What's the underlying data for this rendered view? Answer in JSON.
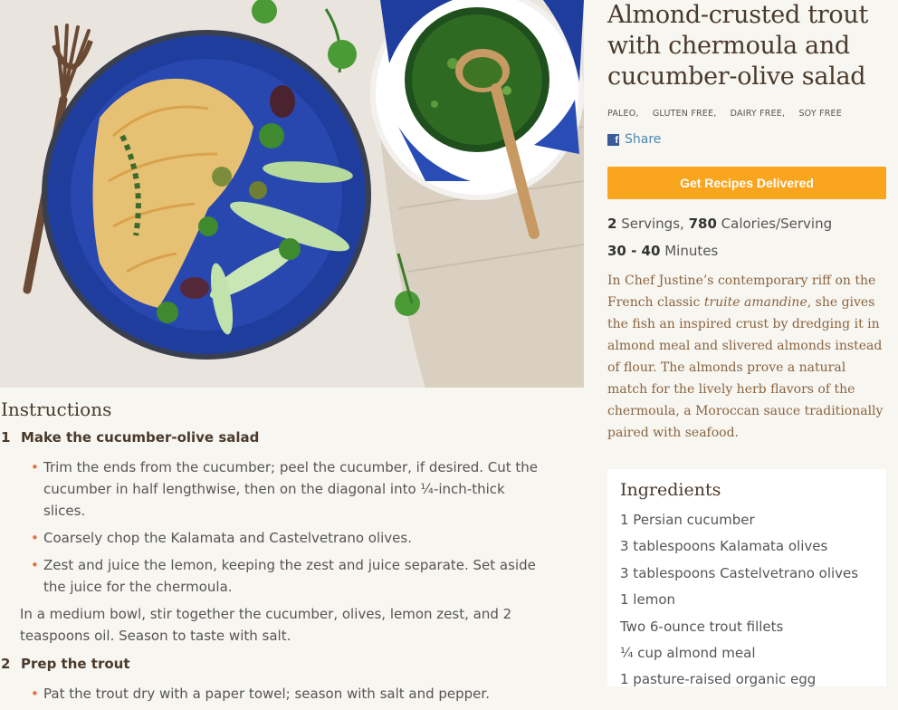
{
  "recipe": {
    "title": "Almond-crusted trout with chermoula and cucumber-olive salad",
    "tags": [
      "PALEO,",
      "GLUTEN FREE,",
      "DAIRY FREE,",
      "SOY FREE"
    ],
    "share_label": "Share",
    "cta_label": "Get Recipes Delivered",
    "servings": "2",
    "servings_label": "Servings,",
    "calories": "780",
    "calories_label": "Calories/Serving",
    "time": "30 - 40",
    "time_label": "Minutes",
    "description_before": "In Chef Justine’s contemporary riff on the French classic ",
    "description_italic": "truite amandine",
    "description_after": ", she gives the fish an inspired crust by dredging it in almond meal and slivered almonds instead of flour. The almonds prove a natural match for the lively herb flavors of the chermoula, a Moroccan sauce traditionally paired with seafood."
  },
  "instructions": {
    "title": "Instructions",
    "steps": [
      {
        "number": "1",
        "heading": "Make the cucumber-olive salad",
        "bullets": [
          "Trim the ends from the cucumber; peel the cucumber, if desired. Cut the cucumber in half lengthwise, then on the diagonal into ¼-inch-thick slices.",
          "Coarsely chop the Kalamata and Castelvetrano olives.",
          "Zest and juice the lemon, keeping the zest and juice separate. Set aside the juice for the chermoula."
        ],
        "paragraph": "In a medium bowl, stir together the cucumber, olives, lemon zest, and 2 teaspoons oil. Season to taste with salt."
      },
      {
        "number": "2",
        "heading": "Prep the trout",
        "bullets": [
          "Pat the trout dry with a paper towel; season with salt and pepper."
        ]
      }
    ]
  },
  "ingredients": {
    "title": "Ingredients",
    "items": [
      "1 Persian cucumber",
      "3 tablespoons Kalamata olives",
      "3 tablespoons Castelvetrano olives",
      "1 lemon",
      "Two 6-ounce trout fillets",
      "¼ cup almond meal",
      "1 pasture-raised organic egg"
    ]
  },
  "colors": {
    "accent_orange": "#f9a51e",
    "bullet_orange": "#e56e3a",
    "link_blue": "#4a8ab3",
    "facebook_blue": "#3b5998",
    "description_brown": "#8a6440",
    "plate_blue": "#1f3d9c"
  }
}
